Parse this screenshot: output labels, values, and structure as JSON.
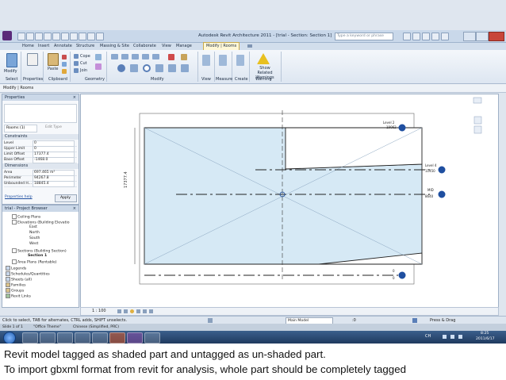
{
  "window": {
    "title": "Autodesk Revit Architecture 2011 - [trial - Section: Section 1]",
    "search_placeholder": "Type a keyword or phrase"
  },
  "ribbon": {
    "tabs": [
      "Home",
      "Insert",
      "Annotate",
      "Structure",
      "Massing & Site",
      "Collaborate",
      "View",
      "Manage",
      "Modify | Rooms"
    ],
    "active_tab": "Modify | Rooms",
    "panels": [
      "Select",
      "Properties",
      "Clipboard",
      "Geometry",
      "Modify",
      "View",
      "Measure",
      "Create",
      "Warning"
    ],
    "buttons": {
      "modify": "Modify",
      "paste": "Paste",
      "cope": "Cope",
      "cut": "Cut",
      "join": "Join",
      "show_related_warnings": "Show Related Warnings"
    }
  },
  "context_bar": {
    "label": "Modify | Rooms"
  },
  "properties": {
    "header": "Properties",
    "type_selector": "Rooms (1)",
    "edit_type": "Edit Type",
    "groups": {
      "constraints": "Constraints",
      "dimensions": "Dimensions"
    },
    "rows": [
      {
        "label": "Level",
        "value": "0"
      },
      {
        "label": "Upper Limit",
        "value": "0"
      },
      {
        "label": "Limit Offset",
        "value": "17377.4"
      },
      {
        "label": "Base Offset",
        "value": "-1468.0"
      },
      {
        "label": "Area",
        "value": "697.465 m²"
      },
      {
        "label": "Perimeter",
        "value": "94267.8"
      },
      {
        "label": "Unbounded H...",
        "value": "18845.4"
      }
    ],
    "help": "Properties help",
    "apply": "Apply"
  },
  "project_browser": {
    "header": "trial - Project Browser",
    "items": [
      {
        "label": "Ceiling Plans",
        "indent": 1
      },
      {
        "label": "Elevations (Building Elevatio",
        "indent": 1
      },
      {
        "label": "East",
        "indent": 2
      },
      {
        "label": "North",
        "indent": 2
      },
      {
        "label": "South",
        "indent": 2
      },
      {
        "label": "West",
        "indent": 2
      },
      {
        "label": "Sections (Building Section)",
        "indent": 1
      },
      {
        "label": "Section 1",
        "indent": 2
      },
      {
        "label": "Area Plans (Rentable)",
        "indent": 1
      },
      {
        "label": "Legends",
        "indent": 0
      },
      {
        "label": "Schedules/Quantities",
        "indent": 0
      },
      {
        "label": "Sheets (all)",
        "indent": 0
      },
      {
        "label": "Families",
        "indent": 0
      },
      {
        "label": "Groups",
        "indent": 0
      },
      {
        "label": "Revit Links",
        "indent": 0
      }
    ]
  },
  "drawing": {
    "dimension": "17377.4",
    "levels": [
      {
        "name": "Level 2",
        "elev": "19062"
      },
      {
        "name": "Level 4",
        "elev": "11450"
      },
      {
        "name": "MID",
        "elev": "8640"
      },
      {
        "name": "0",
        "elev": "0"
      }
    ]
  },
  "view_control_bar": {
    "scale": "1 : 100"
  },
  "status_bar": {
    "hint": "Click to select, TAB for alternates, CTRL adds, SHIFT unselects.",
    "workset": "Main Model",
    "press_drag": "Press & Drag",
    "zoom": ":0"
  },
  "win_status": {
    "page": "Slide 1 of 1",
    "theme": "\"Office Theme\"",
    "language": "Chinese (Simplified, PRC)"
  },
  "taskbar": {
    "ime": "CH",
    "time": "8:25",
    "date": "2011/6/17"
  },
  "caption": {
    "line1": "Revit model tagged as shaded part and untagged as un-shaded part.",
    "line2": "To import gbxml format from revit for analysis, whole part should be completely tagged"
  },
  "colors": {
    "room_fill": "#d6e9f5",
    "level_marker": "#1f4fa0"
  }
}
